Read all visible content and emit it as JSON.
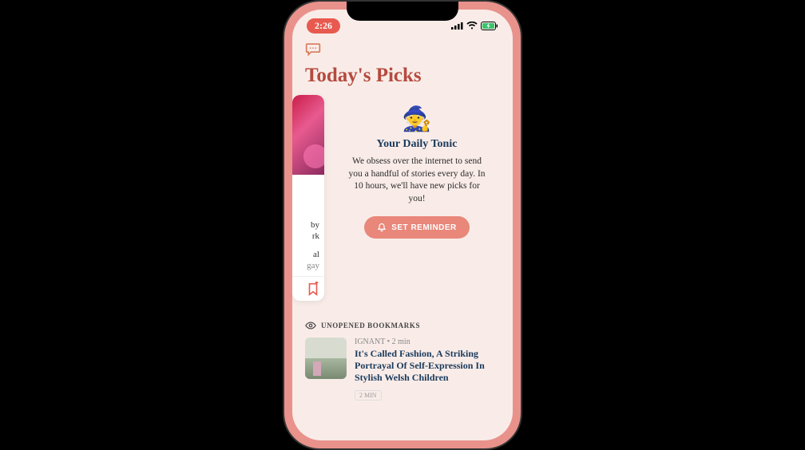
{
  "statusBar": {
    "time": "2:26"
  },
  "header": {
    "title": "Today's Picks"
  },
  "storyCard": {
    "line1": "by",
    "line2": "rk",
    "line3": "al",
    "line4": "gay"
  },
  "tonic": {
    "title": "Your Daily Tonic",
    "body": "We obsess over the internet to send you a handful of stories every day. In 10 hours, we'll have new picks for you!",
    "button": "SET REMINDER"
  },
  "section": {
    "label": "UNOPENED BOOKMARKS"
  },
  "bookmark": {
    "meta": "IGNANT • 2 min",
    "title": "It's Called Fashion, A Striking Portrayal Of Self-Expression In Stylish Welsh Children",
    "pill": "2 MIN"
  }
}
